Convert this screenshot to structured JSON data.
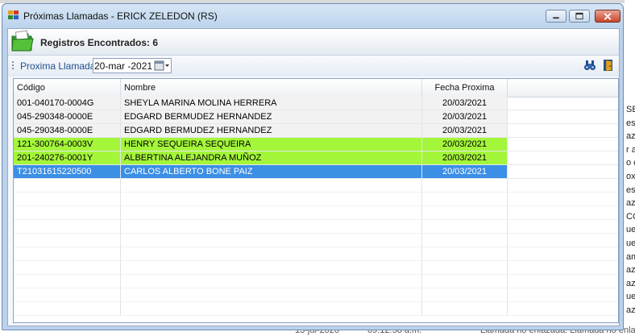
{
  "background": {
    "right_fragments": [
      "SE",
      "est",
      "aza",
      "r al",
      "o c",
      "ox",
      "est",
      "aza",
      "CO",
      "ue",
      "ue",
      "am",
      "aza",
      "aza",
      "ue",
      "aza"
    ],
    "bottom_fragments": [
      "13-jul-2020",
      "09:12:58 a.m.",
      "Llamada no enlazada. Llamada no enlaza"
    ]
  },
  "window": {
    "title": "Próximas Llamadas - ERICK ZELEDON (RS)",
    "header": {
      "records_text": "Registros Encontrados: 6"
    },
    "toolbar": {
      "label": "Proxima Llamada",
      "date_value": "20-mar -2021"
    },
    "grid": {
      "columns": [
        "Código",
        "Nombre",
        "Fecha Proxima"
      ],
      "rows": [
        {
          "codigo": "001-040170-0004G",
          "nombre": "SHEYLA MARINA MOLINA HERRERA",
          "fecha": "20/03/2021",
          "style": "normal"
        },
        {
          "codigo": "045-290348-0000E",
          "nombre": "EDGARD BERMUDEZ HERNANDEZ",
          "fecha": "20/03/2021",
          "style": "normal"
        },
        {
          "codigo": "045-290348-0000E",
          "nombre": "EDGARD BERMUDEZ HERNANDEZ",
          "fecha": "20/03/2021",
          "style": "normal"
        },
        {
          "codigo": "121-300764-0003V",
          "nombre": "HENRY SEQUEIRA SEQUEIRA",
          "fecha": "20/03/2021",
          "style": "green"
        },
        {
          "codigo": "201-240276-0001Y",
          "nombre": "ALBERTINA ALEJANDRA MUÑOZ",
          "fecha": "20/03/2021",
          "style": "green"
        },
        {
          "codigo": "T21031615220500",
          "nombre": "CARLOS ALBERTO BONE PAIZ",
          "fecha": "20/03/2021",
          "style": "selected"
        }
      ]
    }
  },
  "colors": {
    "highlight_green": "#a4f63a",
    "selection_blue": "#3b8fe5"
  },
  "icons": [
    "app-icon",
    "folder-icon",
    "calendar-dropdown-icon",
    "binoculars-icon",
    "exit-door-icon"
  ]
}
